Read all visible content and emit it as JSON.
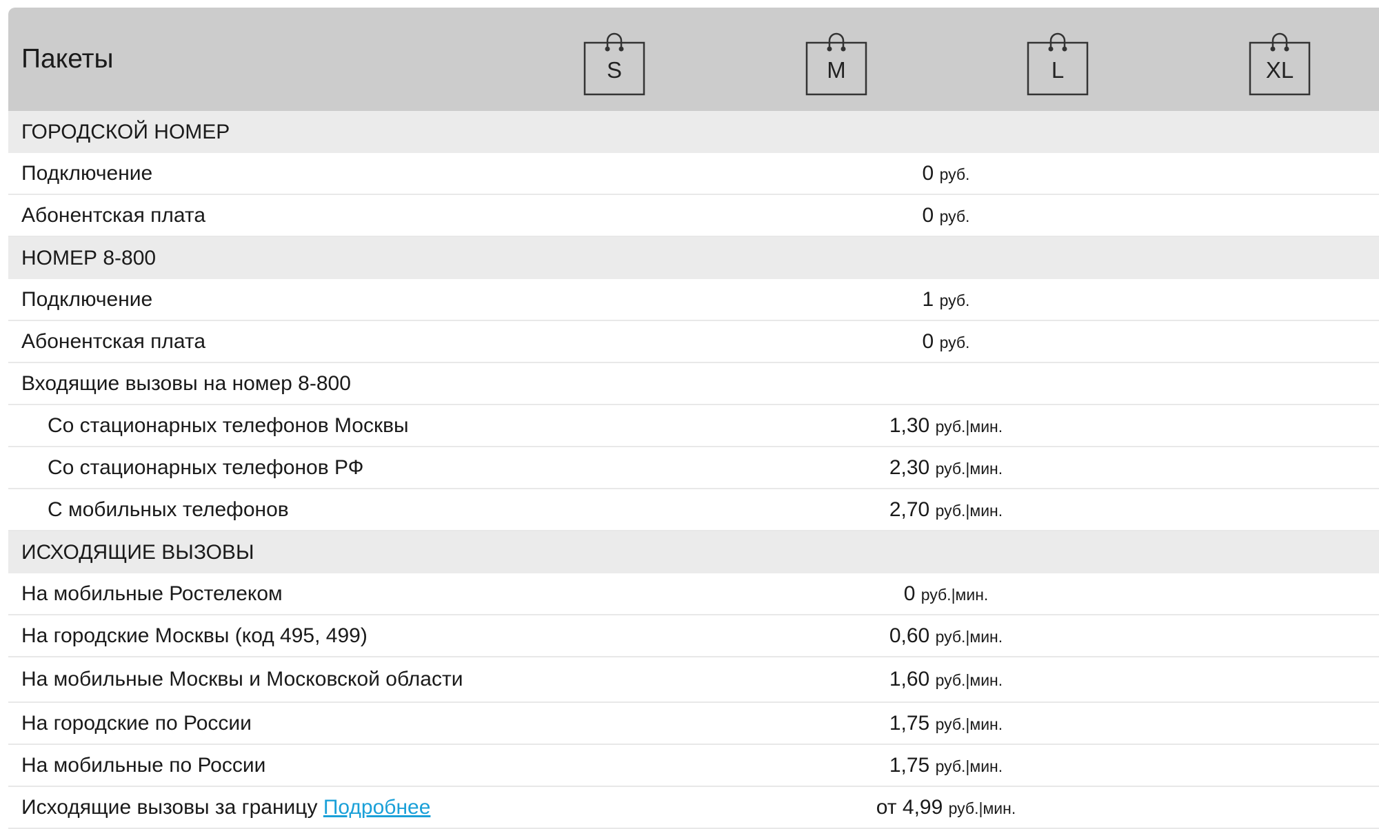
{
  "header": {
    "title": "Пакеты",
    "packages": [
      "S",
      "M",
      "L",
      "XL"
    ]
  },
  "rows": [
    {
      "type": "section",
      "label": "ГОРОДСКОЙ НОМЕР"
    },
    {
      "type": "row",
      "label": "Подключение",
      "prefix": "",
      "amount": "0",
      "unit": "руб."
    },
    {
      "type": "row",
      "label": "Абонентская плата",
      "prefix": "",
      "amount": "0",
      "unit": "руб."
    },
    {
      "type": "section",
      "label": "НОМЕР 8-800"
    },
    {
      "type": "row",
      "label": "Подключение",
      "prefix": "",
      "amount": "1",
      "unit": "руб."
    },
    {
      "type": "row",
      "label": "Абонентская плата",
      "prefix": "",
      "amount": "0",
      "unit": "руб."
    },
    {
      "type": "row",
      "label": "Входящие вызовы на номер 8-800",
      "prefix": "",
      "amount": "",
      "unit": ""
    },
    {
      "type": "sub",
      "label": "Со стационарных телефонов Москвы",
      "prefix": "",
      "amount": "1,30",
      "unit": "руб.|мин."
    },
    {
      "type": "sub",
      "label": "Со стационарных телефонов РФ",
      "prefix": "",
      "amount": "2,30",
      "unit": "руб.|мин."
    },
    {
      "type": "sub",
      "label": "С мобильных телефонов",
      "prefix": "",
      "amount": "2,70",
      "unit": "руб.|мин."
    },
    {
      "type": "section",
      "label": "ИСХОДЯЩИЕ ВЫЗОВЫ"
    },
    {
      "type": "row",
      "label": "На мобильные Ростелеком",
      "prefix": "",
      "amount": "0",
      "unit": "руб.|мин."
    },
    {
      "type": "row",
      "label": "На городские Москвы (код 495, 499)",
      "prefix": "",
      "amount": "0,60",
      "unit": "руб.|мин."
    },
    {
      "type": "tall",
      "label": "На мобильные Москвы и Московской области",
      "prefix": "",
      "amount": "1,60",
      "unit": "руб.|мин."
    },
    {
      "type": "row",
      "label": "На городские по России",
      "prefix": "",
      "amount": "1,75",
      "unit": "руб.|мин."
    },
    {
      "type": "row",
      "label": "На мобильные по России",
      "prefix": "",
      "amount": "1,75",
      "unit": "руб.|мин."
    }
  ],
  "last_row": {
    "label": "Исходящие вызовы за границу",
    "link": "Подробнее",
    "prefix": "от",
    "amount": "4,99",
    "unit": "руб.|мин."
  }
}
